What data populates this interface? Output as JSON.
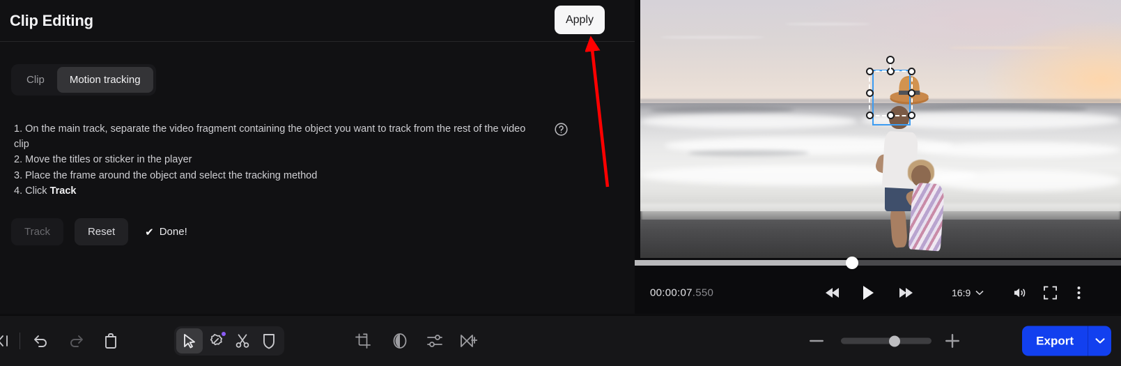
{
  "panel": {
    "title": "Clip Editing",
    "apply_label": "Apply",
    "tabs": [
      {
        "label": "Clip",
        "active": false
      },
      {
        "label": "Motion tracking",
        "active": true
      }
    ],
    "help_icon": "question-circle-icon",
    "instructions": [
      "1. On the main track, separate the video fragment containing the object you want to track from the rest of the video clip",
      "2. Move the titles or sticker in the player",
      "3. Place the frame around the object and select the tracking method",
      "4. Click "
    ],
    "instruction_4_bold": "Track",
    "actions": {
      "track_label": "Track",
      "track_enabled": false,
      "reset_label": "Reset",
      "reset_enabled": true,
      "done_label": "Done!",
      "done_check": "✔"
    }
  },
  "annotation": {
    "type": "arrow",
    "color": "#ff0000",
    "points_to": "apply-button"
  },
  "player": {
    "timecode_main": "00:00:07",
    "timecode_ms": ".550",
    "progress_percent": 44.5,
    "aspect_ratio": "16:9",
    "controls": [
      {
        "name": "rewind-button",
        "icon": "rewind-icon"
      },
      {
        "name": "play-button",
        "icon": "play-icon"
      },
      {
        "name": "fast-forward-button",
        "icon": "fast-forward-icon"
      }
    ],
    "right_controls": [
      {
        "name": "volume-button",
        "icon": "volume-icon"
      },
      {
        "name": "fullscreen-button",
        "icon": "fullscreen-icon"
      },
      {
        "name": "more-options-button",
        "icon": "more-vertical-icon"
      }
    ],
    "selection": {
      "track_frame_color": "#3c9cf2",
      "sticker_frame_style": "dashed-white",
      "sticker": "hat-sticker"
    },
    "scene_description": "beach at sunset with man and girl walking"
  },
  "toolbar": {
    "left_tools": [
      {
        "name": "undo-button",
        "icon": "undo-icon",
        "enabled": true
      },
      {
        "name": "redo-button",
        "icon": "redo-icon",
        "enabled": false
      },
      {
        "name": "delete-button",
        "icon": "trash-icon",
        "enabled": true
      }
    ],
    "tool_group": [
      {
        "name": "select-tool",
        "icon": "cursor-arrow-icon",
        "active": true,
        "badge": false
      },
      {
        "name": "magic-tool",
        "icon": "magic-eraser-icon",
        "active": false,
        "badge": true
      },
      {
        "name": "split-tool",
        "icon": "scissors-icon",
        "active": false,
        "badge": false
      },
      {
        "name": "mask-tool",
        "icon": "shield-mask-icon",
        "active": false,
        "badge": false
      }
    ],
    "right_tools": [
      {
        "name": "crop-tool",
        "icon": "crop-icon"
      },
      {
        "name": "color-tool",
        "icon": "contrast-circle-icon"
      },
      {
        "name": "adjust-tool",
        "icon": "sliders-icon"
      },
      {
        "name": "speed-tool",
        "icon": "speed-icon"
      }
    ],
    "zoom": {
      "minus_icon": "minus-icon",
      "plus_icon": "plus-icon",
      "value_percent": 53
    },
    "export": {
      "label": "Export",
      "caret_icon": "chevron-down-icon",
      "color": "#1240ef"
    }
  }
}
